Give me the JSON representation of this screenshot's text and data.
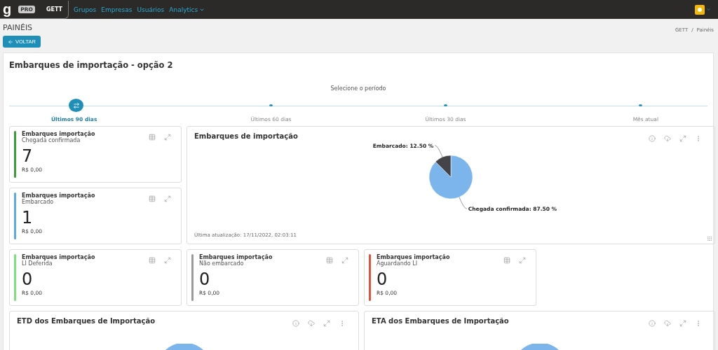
{
  "navbar": {
    "logo": "g",
    "logo_badge": "PRO",
    "company": "GETT",
    "menu": [
      {
        "label": "Grupos",
        "dropdown": false
      },
      {
        "label": "Empresas",
        "dropdown": false
      },
      {
        "label": "Usuários",
        "dropdown": false
      },
      {
        "label": "Analytics",
        "dropdown": true
      }
    ]
  },
  "header": {
    "title": "PAINÉIS",
    "back_button": "VOLTAR",
    "breadcrumb": [
      "GETT",
      "/",
      "Painéis"
    ]
  },
  "panel": {
    "title": "Embarques de importação - opção 2",
    "period": {
      "label": "Selecione o período",
      "steps": [
        {
          "label": "Últimos 90 dias",
          "selected": true
        },
        {
          "label": "Últimos 60 dias",
          "selected": false
        },
        {
          "label": "Últimos 30 dias",
          "selected": false
        },
        {
          "label": "Mês atual",
          "selected": false
        }
      ]
    },
    "kpi_cards": [
      {
        "title": "Embarques importação",
        "subtitle": "Chegada confirmada",
        "value": "7",
        "amount": "R$ 0,00",
        "color": "#3a9d3a"
      },
      {
        "title": "Embarques importação",
        "subtitle": "Embarcado",
        "value": "1",
        "amount": "R$ 0,00",
        "color": "#5aabe0"
      },
      {
        "title": "Embarques importação",
        "subtitle": "LI Deferida",
        "value": "0",
        "amount": "R$ 0,00",
        "color": "#7ddf7d"
      },
      {
        "title": "Embarques importação",
        "subtitle": "Não embarcado",
        "value": "0",
        "amount": "R$ 0,00",
        "color": "#9a9a9a"
      },
      {
        "title": "Embarques importação",
        "subtitle": "Aguardando LI",
        "value": "0",
        "amount": "R$ 0,00",
        "color": "#e0533d"
      }
    ],
    "main_chart": {
      "title": "Embarques de importação",
      "updated": "Última atualização: 17/11/2022, 02:03:11",
      "chart_data": {
        "type": "pie",
        "values": [
          87.5,
          12.5
        ],
        "value_labels": [
          "Chegada confirmada: 87.50 %",
          "Embarcado: 12.50 %"
        ]
      }
    },
    "bottom_charts": [
      {
        "title": "ETD dos Embarques de Importação"
      },
      {
        "title": "ETA dos Embarques de Importação"
      }
    ]
  }
}
